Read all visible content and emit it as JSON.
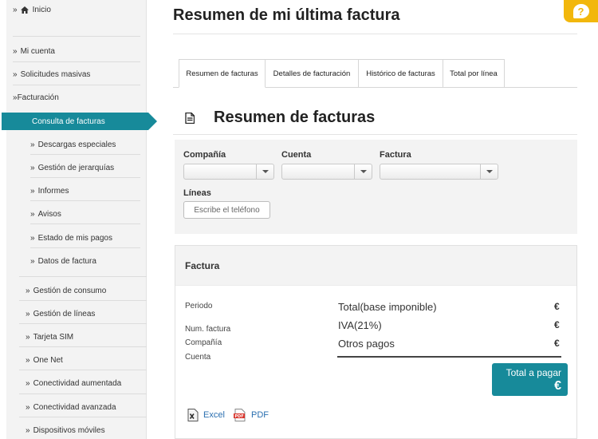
{
  "sidebar": {
    "home": "Inicio",
    "items": [
      {
        "label": "Mi cuenta"
      },
      {
        "label": "Solicitudes masivas"
      },
      {
        "label": "Facturación"
      }
    ],
    "active": "Consulta de facturas",
    "sub_items": [
      {
        "label": "Descargas especiales"
      },
      {
        "label": "Gestión de jerarquías"
      },
      {
        "label": "Informes"
      },
      {
        "label": "Avisos"
      },
      {
        "label": "Estado de mis pagos"
      },
      {
        "label": "Datos de factura"
      }
    ],
    "lower_items": [
      {
        "label": "Gestión de consumo"
      },
      {
        "label": "Gestión de líneas"
      },
      {
        "label": "Tarjeta SIM"
      },
      {
        "label": "One Net"
      },
      {
        "label": "Conectividad aumentada"
      },
      {
        "label": "Conectividad avanzada"
      },
      {
        "label": "Dispositivos móviles"
      }
    ]
  },
  "header": {
    "title": "Resumen de mi última factura",
    "help_symbol": "?"
  },
  "tabs": [
    {
      "label": "Resumen de facturas",
      "active": true
    },
    {
      "label": "Detalles de facturación",
      "active": false
    },
    {
      "label": "Histórico de facturas",
      "active": false
    },
    {
      "label": "Total por línea",
      "active": false
    }
  ],
  "section": {
    "title": "Resumen de facturas"
  },
  "filters": {
    "company_label": "Compañía",
    "account_label": "Cuenta",
    "invoice_label": "Factura",
    "lines_label": "Líneas",
    "phone_placeholder": "Escribe el teléfono"
  },
  "invoice": {
    "header": "Factura",
    "fields": [
      "Periodo",
      "Num. factura",
      "Compañía",
      "Cuenta"
    ],
    "amounts": [
      {
        "label": "Total(base imponible)",
        "value": "€"
      },
      {
        "label": "IVA(21%)",
        "value": "€"
      },
      {
        "label": "Otros pagos",
        "value": "€"
      }
    ],
    "total_label": "Total a pagar",
    "total_value": "€",
    "downloads": {
      "excel": "Excel",
      "pdf": "PDF"
    }
  },
  "colors": {
    "accent": "#178a9a",
    "help": "#f2b70c"
  }
}
